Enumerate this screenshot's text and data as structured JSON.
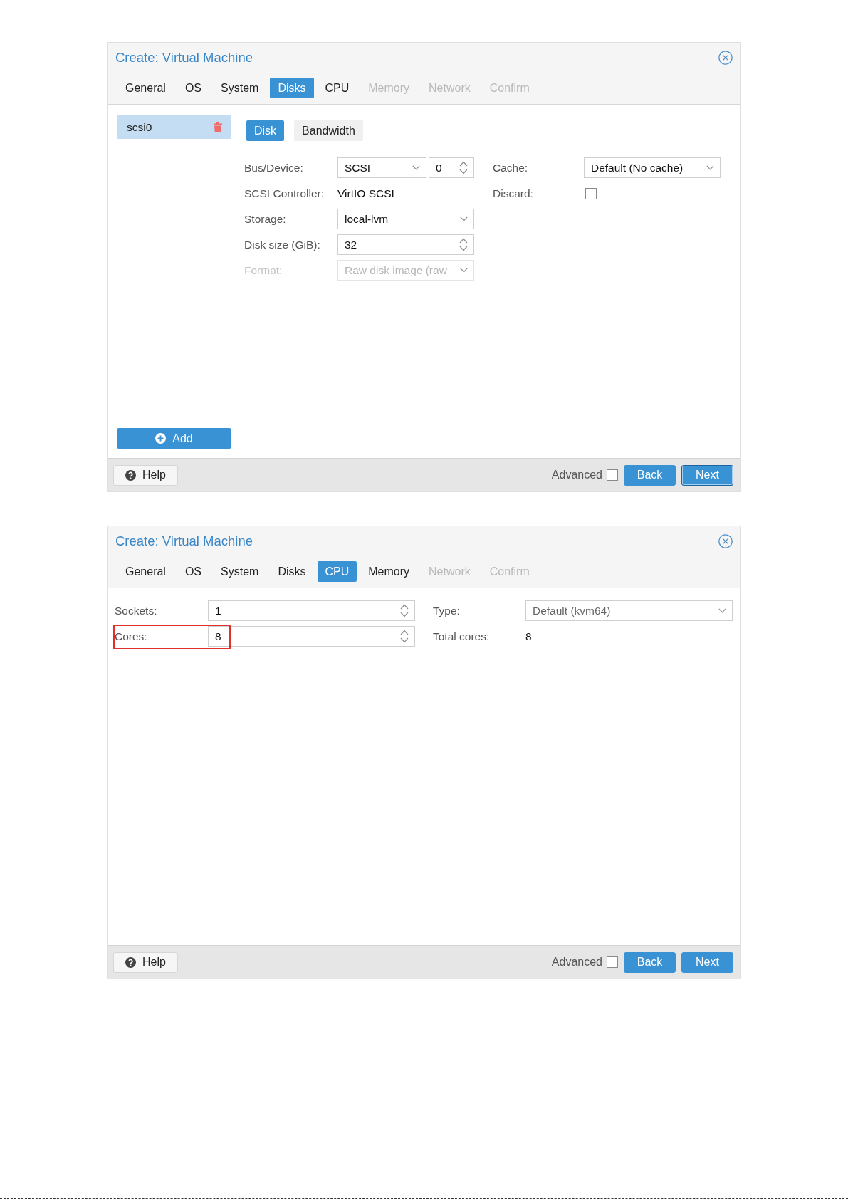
{
  "dialogs": [
    {
      "kind": "disks",
      "title": "Create: Virtual Machine",
      "tabs": [
        {
          "label": "General",
          "selected": false,
          "disabled": false
        },
        {
          "label": "OS",
          "selected": false,
          "disabled": false
        },
        {
          "label": "System",
          "selected": false,
          "disabled": false
        },
        {
          "label": "Disks",
          "selected": true,
          "disabled": false
        },
        {
          "label": "CPU",
          "selected": false,
          "disabled": false
        },
        {
          "label": "Memory",
          "selected": false,
          "disabled": true
        },
        {
          "label": "Network",
          "selected": false,
          "disabled": true
        },
        {
          "label": "Confirm",
          "selected": false,
          "disabled": true
        }
      ],
      "disk_list": {
        "items": [
          {
            "label": "scsi0",
            "selected": true
          }
        ],
        "add_button": "Add"
      },
      "subtabs": [
        {
          "label": "Disk",
          "selected": true
        },
        {
          "label": "Bandwidth",
          "selected": false
        }
      ],
      "form_left": [
        {
          "kind": "select_spinner",
          "label": "Bus/Device:",
          "value": "SCSI",
          "value_2": "0",
          "disabled": false
        },
        {
          "kind": "text",
          "label": "SCSI Controller:",
          "value": "VirtIO SCSI",
          "disabled": false
        },
        {
          "kind": "select",
          "label": "Storage:",
          "value": "local-lvm",
          "disabled": false
        },
        {
          "kind": "spinner",
          "label": "Disk size (GiB):",
          "value": "32",
          "disabled": false
        },
        {
          "kind": "select",
          "label": "Format:",
          "value": "Raw disk image (raw",
          "disabled": true
        }
      ],
      "form_right": [
        {
          "kind": "select",
          "label": "Cache:",
          "value": "Default (No cache)",
          "disabled": false
        },
        {
          "kind": "checkbox",
          "label": "Discard:",
          "checked": false,
          "disabled": false
        }
      ],
      "footer": {
        "help_button": "Help",
        "advanced": {
          "label": "Advanced",
          "checked": false
        },
        "buttons": [
          {
            "label": "Back",
            "focused": false
          },
          {
            "label": "Next",
            "focused": true
          }
        ]
      }
    },
    {
      "kind": "cpu",
      "title": "Create: Virtual Machine",
      "tabs": [
        {
          "label": "General",
          "selected": false,
          "disabled": false
        },
        {
          "label": "OS",
          "selected": false,
          "disabled": false
        },
        {
          "label": "System",
          "selected": false,
          "disabled": false
        },
        {
          "label": "Disks",
          "selected": false,
          "disabled": false
        },
        {
          "label": "CPU",
          "selected": true,
          "disabled": false
        },
        {
          "label": "Memory",
          "selected": false,
          "disabled": false
        },
        {
          "label": "Network",
          "selected": false,
          "disabled": true
        },
        {
          "label": "Confirm",
          "selected": false,
          "disabled": true
        }
      ],
      "form_left": [
        {
          "kind": "spinner",
          "label": "Sockets:",
          "value": "1",
          "disabled": false,
          "highlighted": false
        },
        {
          "kind": "spinner",
          "label": "Cores:",
          "value": "8",
          "disabled": false,
          "highlighted": true
        }
      ],
      "form_right": [
        {
          "kind": "select",
          "label": "Type:",
          "placeholder": "Default (kvm64)",
          "disabled": false,
          "highlighted": false
        },
        {
          "kind": "text",
          "label": "Total cores:",
          "value": "8",
          "disabled": false,
          "highlighted": false
        }
      ],
      "footer": {
        "help_button": "Help",
        "advanced": {
          "label": "Advanced",
          "checked": false
        },
        "buttons": [
          {
            "label": "Back",
            "focused": false
          },
          {
            "label": "Next",
            "focused": false
          }
        ]
      }
    }
  ]
}
